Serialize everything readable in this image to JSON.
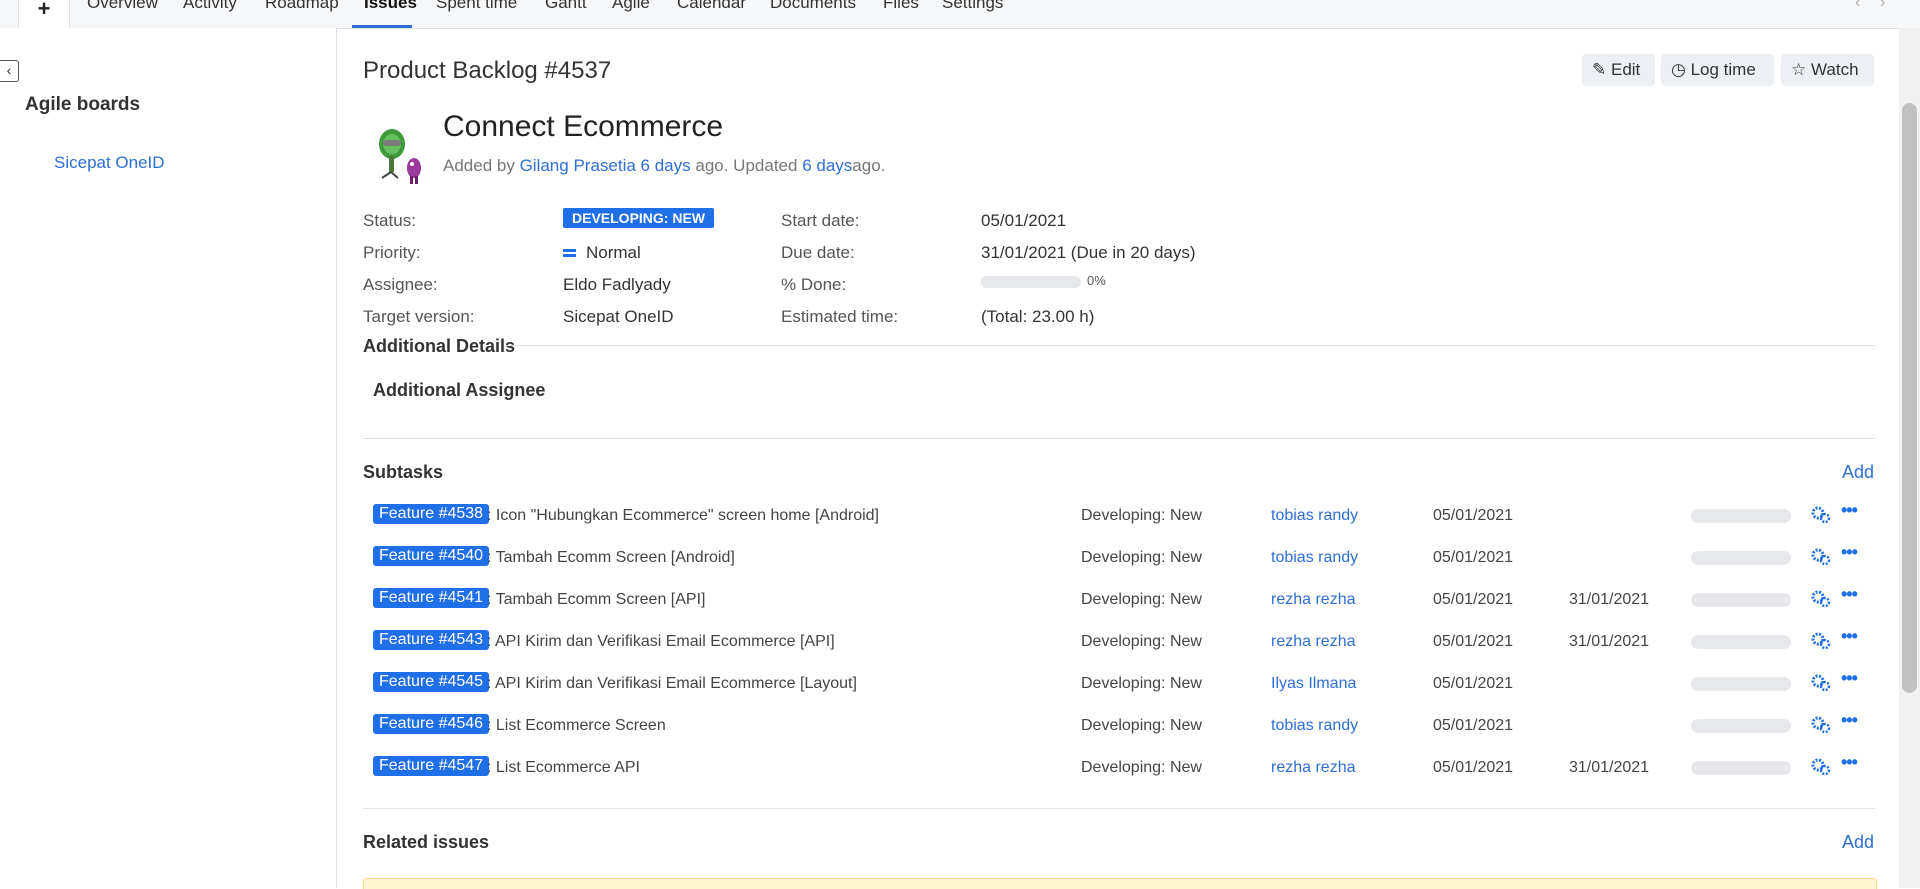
{
  "nav": {
    "plus": "+",
    "tabs": [
      "Overview",
      "Activity",
      "Roadmap",
      "Issues",
      "Spent time",
      "Gantt",
      "Agile",
      "Calendar",
      "Documents",
      "Files",
      "Settings"
    ],
    "active_tab": "Issues",
    "prev_arrow": "‹",
    "next_arrow": "›"
  },
  "sidebar": {
    "collapse_icon": "‹",
    "title": "Agile boards",
    "link": "Sicepat OneID"
  },
  "issue": {
    "heading": "Product Backlog #4537",
    "buttons": {
      "edit": "Edit",
      "log_time": "Log time",
      "watch": "Watch"
    },
    "subject": "Connect Ecommerce",
    "author_prefix": "Added by",
    "author": "Gilang Prasetia",
    "added_ago": "6 days",
    "updated_text": "ago. Updated",
    "updated_ago": "6 days",
    "suffix": "ago."
  },
  "attributes": {
    "status_label": "Status:",
    "status": "DEVELOPING: NEW",
    "priority_label": "Priority:",
    "priority": "Normal",
    "assignee_label": "Assignee:",
    "assignee": "Eldo Fadlyady",
    "target_label": "Target version:",
    "target": "Sicepat OneID",
    "start_label": "Start date:",
    "start": "05/01/2021",
    "due_label": "Due date:",
    "due": "31/01/2021 (Due in 20 days)",
    "done_label": "% Done:",
    "done": "0%",
    "done_fraction": 0,
    "estimated_label": "Estimated time:",
    "estimated": "(Total: 23.00 h)"
  },
  "additional": {
    "title": "Additional Details",
    "assignee_title": "Additional Assignee"
  },
  "subtasks": {
    "title": "Subtasks",
    "add": "Add",
    "rows": [
      {
        "id": "Feature #4538",
        "subject": ": Icon \"Hubungkan Ecommerce\" screen home [Android]",
        "status": "Developing: New",
        "assignee": "tobias randy",
        "start": "05/01/2021",
        "due": ""
      },
      {
        "id": "Feature #4540",
        "subject": ": Tambah Ecomm Screen [Android]",
        "status": "Developing: New",
        "assignee": "tobias randy",
        "start": "05/01/2021",
        "due": ""
      },
      {
        "id": "Feature #4541",
        "subject": ": Tambah Ecomm Screen [API]",
        "status": "Developing: New",
        "assignee": "rezha rezha",
        "start": "05/01/2021",
        "due": "31/01/2021"
      },
      {
        "id": "Feature #4543",
        "subject": ": API Kirim dan Verifikasi Email Ecommerce [API]",
        "status": "Developing: New",
        "assignee": "rezha rezha",
        "start": "05/01/2021",
        "due": "31/01/2021"
      },
      {
        "id": "Feature #4545",
        "subject": ": API Kirim dan Verifikasi Email Ecommerce [Layout]",
        "status": "Developing: New",
        "assignee": "Ilyas Ilmana",
        "start": "05/01/2021",
        "due": ""
      },
      {
        "id": "Feature #4546",
        "subject": ": List Ecommerce Screen",
        "status": "Developing: New",
        "assignee": "tobias randy",
        "start": "05/01/2021",
        "due": ""
      },
      {
        "id": "Feature #4547",
        "subject": ": List Ecommerce API",
        "status": "Developing: New",
        "assignee": "rezha rezha",
        "start": "05/01/2021",
        "due": "31/01/2021"
      }
    ],
    "more_icon": "•••"
  },
  "related": {
    "title": "Related issues",
    "add": "Add"
  },
  "colors": {
    "accent": "#1f6fe8",
    "link": "#2e6fd6",
    "flash_bg": "#fff5d1"
  },
  "icons": {
    "edit": "pencil-icon",
    "log_time": "clock-icon",
    "watch": "star-icon",
    "subtask_gear": "gears-icon",
    "subtask_more": "ellipsis-icon"
  }
}
